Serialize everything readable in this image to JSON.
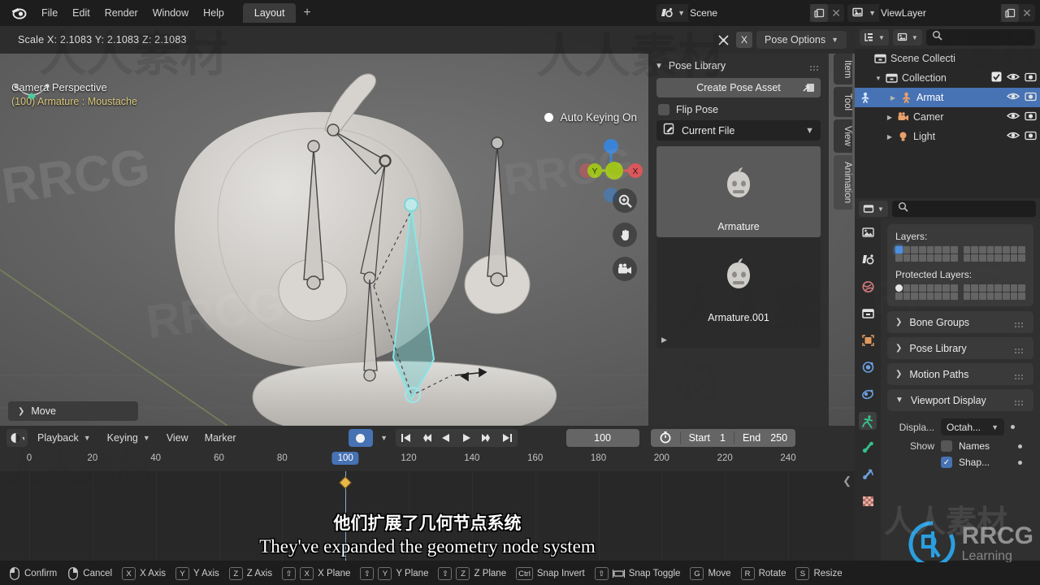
{
  "topbar": {
    "menus": [
      "File",
      "Edit",
      "Render",
      "Window",
      "Help"
    ],
    "workspace_tab": "Layout",
    "add_workspace": "+",
    "scene_name": "Scene",
    "viewlayer_name": "ViewLayer",
    "logo_icon": "blender-logo-icon",
    "scene_icon": "scene-icon",
    "viewlayer_icon": "viewlayer-icon",
    "new_icon": "duplicate-icon",
    "close_icon": "x-icon"
  },
  "viewport": {
    "scale_text": "Scale X: 2.1083   Y: 2.1083  Z: 2.1083",
    "pose_options_label": "Pose Options",
    "x_label": "X",
    "mirror_icon": "x-mirror-icon",
    "camera_line": "Camera Perspective",
    "armature_line": "(100) Armature : Moustache",
    "autokey_label": "Auto Keying On",
    "gizmo_axes": [
      "X",
      "Y",
      "Z"
    ],
    "tools": [
      "zoom-icon",
      "pan-icon",
      "camera-icon"
    ],
    "operator_panel": "Move"
  },
  "npanel": {
    "title": "Pose Library",
    "create_pose_asset": "Create Pose Asset",
    "flip_pose": "Flip Pose",
    "library_source": "Current File",
    "library_icon": "file-edit-icon",
    "assets": [
      {
        "name": "Armature",
        "selected": true
      },
      {
        "name": "Armature.001",
        "selected": false
      }
    ],
    "tabs": [
      "Item",
      "Tool",
      "View",
      "Animation"
    ],
    "active_tab": "Animation"
  },
  "timeline": {
    "editor_icon": "timeline-editor-icon",
    "menus": [
      "Playback",
      "Keying",
      "View",
      "Marker"
    ],
    "menus_with_chevron": [
      "Playback",
      "Keying"
    ],
    "record_icon": "record-icon",
    "transport": [
      "jump-start-icon",
      "prev-keyframe-icon",
      "play-reverse-icon",
      "play-icon",
      "next-keyframe-icon",
      "jump-end-icon"
    ],
    "current_frame": "100",
    "timer_icon": "stopwatch-icon",
    "start_label": "Start",
    "start_value": "1",
    "end_label": "End",
    "end_value": "250",
    "ruler_ticks": [
      "0",
      "20",
      "40",
      "60",
      "80",
      "100",
      "120",
      "140",
      "160",
      "180",
      "200",
      "220",
      "240"
    ],
    "playhead_frame": "100",
    "keyframes": [
      "100"
    ]
  },
  "outliner": {
    "display_mode_icon": "view-layer-icon",
    "filter_icon": "filter-icon",
    "search_icon": "search-icon",
    "search_placeholder": "",
    "rows": [
      {
        "label": "Scene Collecti",
        "icon": "collection-icon",
        "indent": 0,
        "tri": "",
        "checkbox": false,
        "eye": false,
        "camera": false,
        "selected": false
      },
      {
        "label": "Collection",
        "icon": "collection-icon",
        "indent": 1,
        "tri": "▼",
        "checkbox": true,
        "eye": true,
        "camera": true,
        "selected": false
      },
      {
        "label": "Armat",
        "icon": "armature-icon",
        "indent": 2,
        "tri": "▶",
        "checkbox": false,
        "eye": true,
        "camera": true,
        "selected": true
      },
      {
        "label": "Camer",
        "icon": "camera-obj-icon",
        "indent": 2,
        "tri": "▶",
        "checkbox": false,
        "eye": true,
        "camera": true,
        "selected": false
      },
      {
        "label": "Light",
        "icon": "light-icon",
        "indent": 2,
        "tri": "▶",
        "checkbox": false,
        "eye": true,
        "camera": true,
        "selected": false
      }
    ]
  },
  "properties": {
    "editor_icon": "properties-editor-icon",
    "search_icon": "search-icon",
    "tabs": [
      "tool-icon",
      "render-icon",
      "output-icon",
      "viewlayer-props-icon",
      "scene-props-icon",
      "world-icon",
      "collection-props-icon",
      "object-icon",
      "modifier-icon",
      "particles-icon",
      "physics-icon",
      "object-data-icon",
      "bone-icon",
      "bone-constraint-icon",
      "material-icon"
    ],
    "active_tab_index": 11,
    "layers_label": "Layers:",
    "protected_layers_label": "Protected Layers:",
    "sections": [
      {
        "label": "Bone Groups",
        "open": false
      },
      {
        "label": "Pose Library",
        "open": false
      },
      {
        "label": "Motion Paths",
        "open": false
      },
      {
        "label": "Viewport Display",
        "open": true
      }
    ],
    "viewport_display": {
      "display_as_label": "Displa...",
      "display_as_value": "Octah...",
      "show_label": "Show",
      "names_label": "Names",
      "names_checked": false,
      "shapes_label": "Shap...",
      "shapes_checked": true
    }
  },
  "statusbar": {
    "items": [
      {
        "keys": [
          "mouse-left-icon"
        ],
        "label": "Confirm"
      },
      {
        "keys": [
          "mouse-right-icon"
        ],
        "label": "Cancel"
      },
      {
        "keys": [
          "X"
        ],
        "label": "X Axis"
      },
      {
        "keys": [
          "Y"
        ],
        "label": "Y Axis"
      },
      {
        "keys": [
          "Z"
        ],
        "label": "Z Axis"
      },
      {
        "keys": [
          "⇧",
          "X"
        ],
        "label": "X Plane"
      },
      {
        "keys": [
          "⇧",
          "Y"
        ],
        "label": "Y Plane"
      },
      {
        "keys": [
          "⇧",
          "Z"
        ],
        "label": "Z Plane"
      },
      {
        "keys": [
          "Ctrl"
        ],
        "label": "Snap Invert"
      },
      {
        "keys": [
          "⇧",
          "snap-icon"
        ],
        "label": "Snap Toggle"
      },
      {
        "keys": [
          "G"
        ],
        "label": "Move"
      },
      {
        "keys": [
          "R"
        ],
        "label": "Rotate"
      },
      {
        "keys": [
          "S"
        ],
        "label": "Resize"
      }
    ]
  },
  "subtitles": {
    "chinese": "他们扩展了几何节点系统",
    "english": "They've expanded the geometry node system"
  },
  "watermarks": {
    "rrcg": "RRCG",
    "cn": "人人素材",
    "brand_line": "Learning"
  },
  "colors": {
    "accent_blue": "#4772b3",
    "armature_orange": "#e9a06a",
    "axis_x": "#d9565a",
    "axis_y": "#9ec21a",
    "axis_z": "#3b83d6",
    "keyframe": "#e8b949",
    "header_text": "#dcc77a"
  }
}
